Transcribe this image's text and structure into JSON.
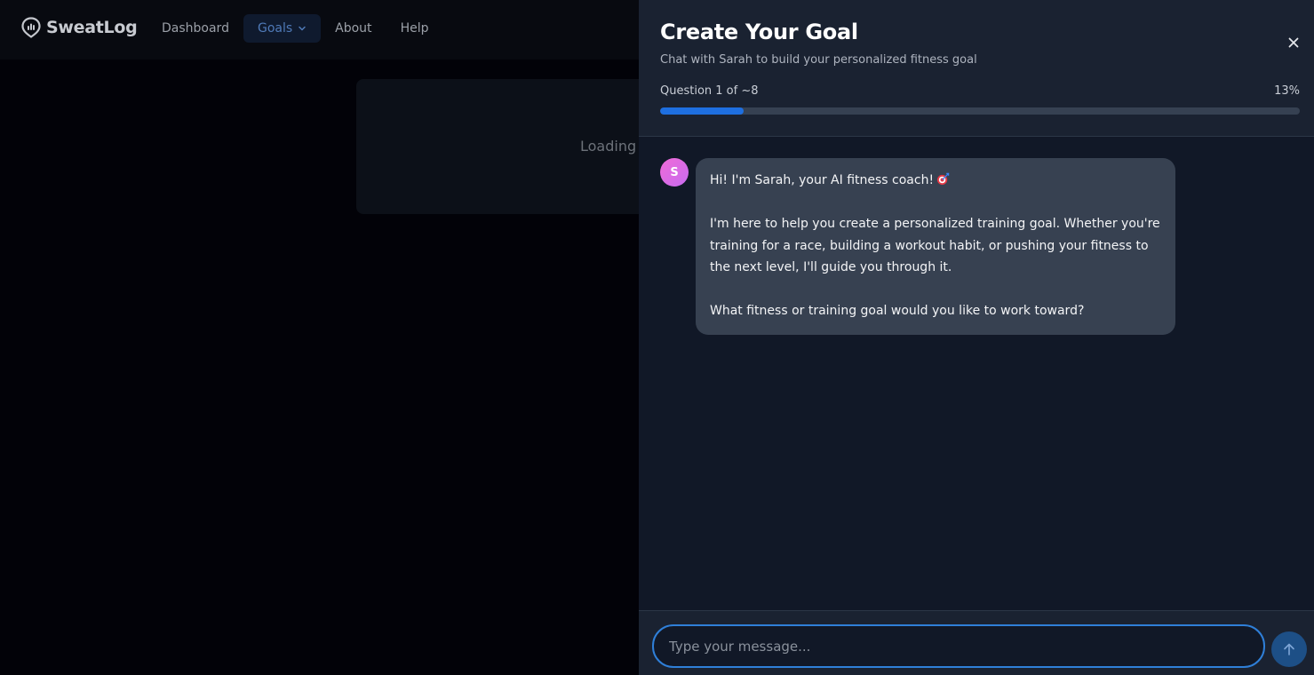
{
  "app": {
    "brand": "SweatLog",
    "nav": [
      {
        "label": "Dashboard",
        "icon": ""
      },
      {
        "label": "Goals",
        "icon": "chevron-down-icon"
      },
      {
        "label": "About",
        "icon": ""
      },
      {
        "label": "Help",
        "icon": ""
      }
    ],
    "active_nav": "Goals",
    "loading_text": "Loading g"
  },
  "panel": {
    "title": "Create Your Goal",
    "subtitle": "Chat with Sarah to build your personalized fitness goal",
    "close_icon": "close-icon",
    "progress": {
      "label": "Question 1 of ~8",
      "percent_label": "13%",
      "value": 13
    },
    "messages": [
      {
        "sender_initial": "S",
        "paragraphs": [
          "Hi! I'm Sarah, your AI fitness coach!",
          "I'm here to help you create a personalized training goal. Whether you're training for a race, building a workout habit, or pushing your fitness to the next level, I'll guide you through it.",
          "What fitness or training goal would you like to work toward?"
        ],
        "emoji_icon": "dart-target-icon"
      }
    ],
    "composer": {
      "placeholder": "Type your message...",
      "value": "",
      "send_icon": "arrow-up-icon"
    }
  },
  "colors": {
    "accent": "#1e6fe0",
    "input_border": "#2f7fd8",
    "avatar": "#e56bdf",
    "panel_bg": "#111827",
    "bubble_bg": "#374151"
  }
}
